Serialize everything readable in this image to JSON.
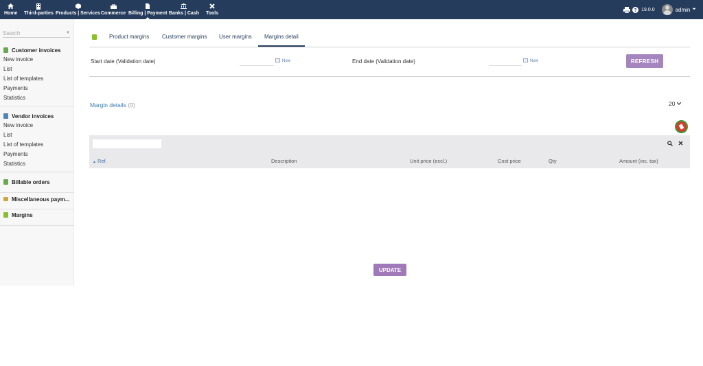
{
  "topbar": {
    "menu": [
      {
        "label": "Home",
        "icon": "home-icon"
      },
      {
        "label": "Third-parties",
        "icon": "building-icon"
      },
      {
        "label": "Products | Services",
        "icon": "cube-icon"
      },
      {
        "label": "Commerce",
        "icon": "briefcase-icon"
      },
      {
        "label": "Billing | Payment",
        "icon": "file-invoice-icon"
      },
      {
        "label": "Banks | Cash",
        "icon": "bank-icon"
      },
      {
        "label": "Tools",
        "icon": "wrench-icon"
      }
    ],
    "version": "19.0.0",
    "username": "admin"
  },
  "sidebar": {
    "search_placeholder": "Search",
    "sections": [
      {
        "title": "Customer invoices",
        "color": "#6aa84f",
        "links": [
          "New invoice",
          "List",
          "List of templates",
          "Payments",
          "Statistics"
        ]
      },
      {
        "title": "Vendor invoices",
        "color": "#4a86b8",
        "links": [
          "New invoice",
          "List",
          "List of templates",
          "Payments",
          "Statistics"
        ]
      },
      {
        "title": "Billable orders",
        "color": "#6aa84f",
        "links": []
      },
      {
        "title": "Miscellaneous paym...",
        "color": "#c9a93b",
        "links": []
      },
      {
        "title": "Margins",
        "color": "#8bbf2f",
        "links": []
      }
    ]
  },
  "tabs": [
    {
      "label": "Product margins",
      "active": false
    },
    {
      "label": "Customer margins",
      "active": false
    },
    {
      "label": "User margins",
      "active": false
    },
    {
      "label": "Margins detail",
      "active": true
    }
  ],
  "filters": {
    "start_label": "Start date (Validation date)",
    "end_label": "End date (Validation date)",
    "now_label": "Now",
    "refresh_label": "REFRESH"
  },
  "list": {
    "title": "Margin details",
    "count": "(0)",
    "limit": "20",
    "columns": [
      "Ref.",
      "Description",
      "Unit price (excl.)",
      "Cost price",
      "Qty",
      "Amount (inc. tax)"
    ]
  },
  "update_label": "UPDATE",
  "colors": {
    "topbar": "#263c5c",
    "button": "#a485be",
    "link": "#3b7bb3"
  }
}
